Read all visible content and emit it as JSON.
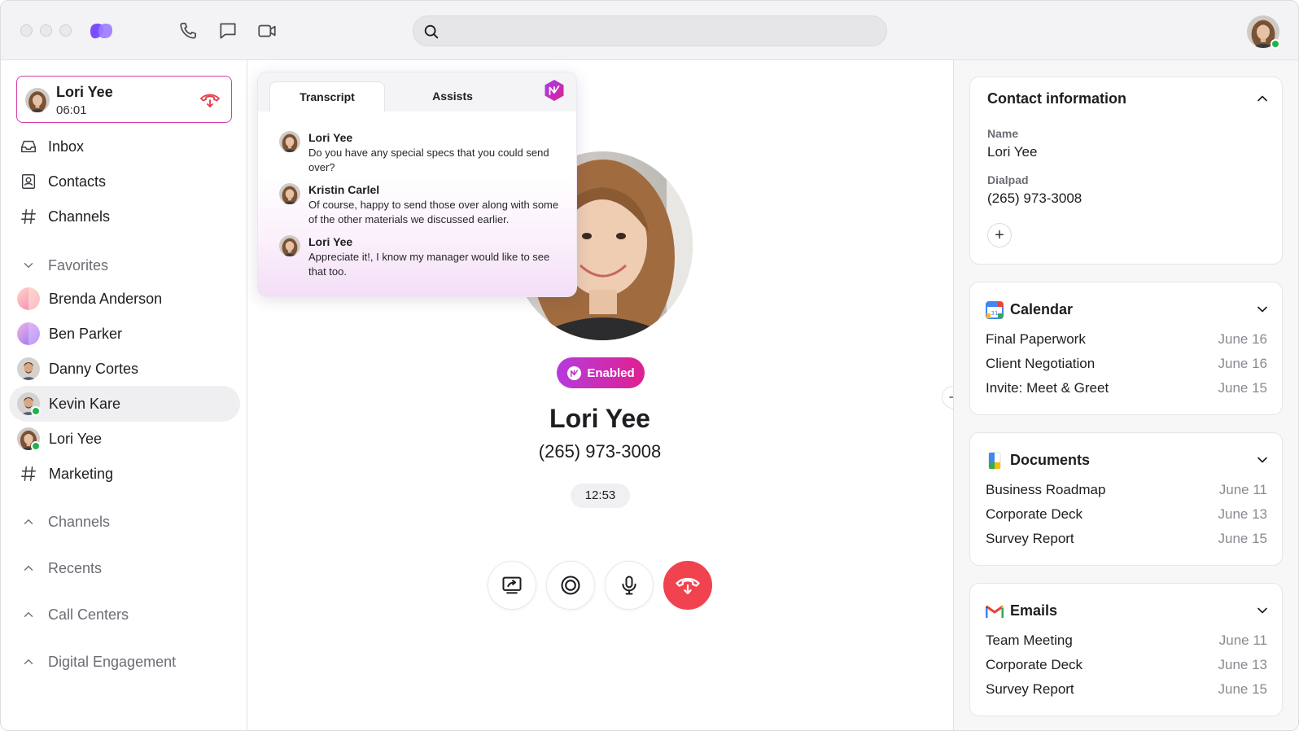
{
  "app": {
    "search": {
      "placeholder": "",
      "value": ""
    }
  },
  "active_call": {
    "name": "Lori Yee",
    "duration": "06:01"
  },
  "nav": [
    {
      "label": "Inbox"
    },
    {
      "label": "Contacts"
    },
    {
      "label": "Channels"
    }
  ],
  "favorites": {
    "header": "Favorites",
    "items": [
      {
        "label": "Brenda Anderson"
      },
      {
        "label": "Ben Parker"
      },
      {
        "label": "Danny Cortes"
      },
      {
        "label": "Kevin Kare"
      },
      {
        "label": "Lori Yee"
      },
      {
        "label": "Marketing"
      }
    ]
  },
  "sections": [
    {
      "label": "Channels"
    },
    {
      "label": "Recents"
    },
    {
      "label": "Call Centers"
    },
    {
      "label": "Digital Engagement"
    }
  ],
  "transcript_panel": {
    "tabs": [
      {
        "label": "Transcript"
      },
      {
        "label": "Assists"
      }
    ],
    "messages": [
      {
        "speaker": "Lori Yee",
        "text": "Do you have any special specs that you could send over?"
      },
      {
        "speaker": "Kristin Carlel",
        "text": "Of course, happy to send those over along with some of the other materials we discussed earlier."
      },
      {
        "speaker": "Lori Yee",
        "text": "Appreciate it!, I know my manager would like to see that too."
      }
    ]
  },
  "call": {
    "ai_status": "Enabled",
    "caller_name": "Lori Yee",
    "caller_phone": "(265) 973-3008",
    "timer": "12:53"
  },
  "contact_card": {
    "title": "Contact information",
    "name_label": "Name",
    "name_value": "Lori Yee",
    "dialpad_label": "Dialpad",
    "dialpad_value": "(265) 973-3008",
    "add_symbol": "+"
  },
  "calendar_card": {
    "title": "Calendar",
    "icon": "google-calendar-icon",
    "items": [
      {
        "title": "Final Paperwork",
        "date": "June 16"
      },
      {
        "title": "Client Negotiation",
        "date": "June 16"
      },
      {
        "title": "Invite: Meet & Greet",
        "date": "June 15"
      }
    ]
  },
  "documents_card": {
    "title": "Documents",
    "icon": "google-drive-icon",
    "items": [
      {
        "title": "Business Roadmap",
        "date": "June 11"
      },
      {
        "title": "Corporate Deck",
        "date": "June 13"
      },
      {
        "title": "Survey Report",
        "date": "June 15"
      }
    ]
  },
  "emails_card": {
    "title": "Emails",
    "icon": "gmail-icon",
    "items": [
      {
        "title": "Team Meeting",
        "date": "June 11"
      },
      {
        "title": "Corporate Deck",
        "date": "June 13"
      },
      {
        "title": "Survey Report",
        "date": "June 15"
      }
    ]
  },
  "colors": {
    "accent_magenta": "#d33ea8",
    "end_call_red": "#f0434f",
    "presence_green": "#22b24c",
    "brand_purple": "#7b4dff"
  }
}
